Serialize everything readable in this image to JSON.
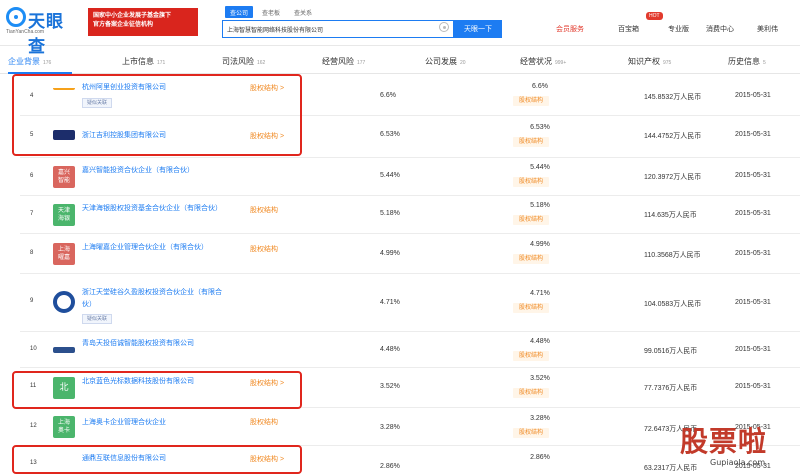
{
  "header": {
    "logo_text": "天眼查",
    "logo_domain": "TianYanCha.com",
    "gov_badge_line1": "国家中小企业发展子基金旗下",
    "gov_badge_line2": "官方备案企业征信机构",
    "search_tabs": [
      "查公司",
      "查老板",
      "查关系"
    ],
    "search_value": "上海智慧智能网络科技股份有限公司",
    "search_button": "天眼一下",
    "nav": {
      "vip": "会员服务",
      "hot": "HOT",
      "enterprise": "百宝箱",
      "pro": "专业版",
      "consume": "消费中心",
      "user": "美利伟"
    }
  },
  "tabs": [
    {
      "label": "企业背景",
      "count": "176"
    },
    {
      "label": "上市信息",
      "count": "171"
    },
    {
      "label": "司法风险",
      "count": "162"
    },
    {
      "label": "经营风险",
      "count": "177"
    },
    {
      "label": "公司发展",
      "count": "20"
    },
    {
      "label": "经营状况",
      "count": "999+"
    },
    {
      "label": "知识产权",
      "count": "975"
    },
    {
      "label": "历史信息",
      "count": "5"
    }
  ],
  "rows": [
    {
      "num": "4",
      "logo_text": "",
      "logo_color": "#f6a11a",
      "name": "杭州阿里创业投资有限公司",
      "tag": "疑似关联",
      "equity": "股权结构 >",
      "pct": "6.6%",
      "pct2": "6.6%",
      "capital": "145.8532万人民币",
      "date": "2015-05-31"
    },
    {
      "num": "5",
      "logo_text": "",
      "logo_color": "#1c2d6b",
      "name": "浙江吉利控股集团有限公司",
      "tag": "",
      "equity": "股权结构 >",
      "pct": "6.53%",
      "pct2": "6.53%",
      "capital": "144.4752万人民币",
      "date": "2015-05-31"
    },
    {
      "num": "6",
      "logo_text": "嘉兴\n智能",
      "logo_color": "#d9665e",
      "name": "嘉兴智能投资合伙企业（有限合伙）",
      "tag": "",
      "equity": "",
      "pct": "5.44%",
      "pct2": "5.44%",
      "capital": "120.3972万人民币",
      "date": "2015-05-31"
    },
    {
      "num": "7",
      "logo_text": "天津\n海银",
      "logo_color": "#4bb56c",
      "name": "天津海银股权投资基金合伙企业（有限合伙）",
      "tag": "",
      "equity": "股权结构",
      "pct": "5.18%",
      "pct2": "5.18%",
      "capital": "114.635万人民币",
      "date": "2015-05-31"
    },
    {
      "num": "8",
      "logo_text": "上海\n曜嘉",
      "logo_color": "#d9665e",
      "name": "上海曜嘉企业管理合伙企业（有限合伙）",
      "tag": "",
      "equity": "股权结构",
      "pct": "4.99%",
      "pct2": "4.99%",
      "capital": "110.3568万人民币",
      "date": "2015-05-31"
    },
    {
      "num": "9",
      "logo_text": "",
      "logo_color": "#1f4e9c",
      "name": "浙江天堂硅谷久盈股权投资合伙企业（有限合伙）",
      "tag": "疑似关联",
      "equity": "",
      "pct": "4.71%",
      "pct2": "4.71%",
      "capital": "104.0583万人民币",
      "date": "2015-05-31"
    },
    {
      "num": "10",
      "logo_text": "",
      "logo_color": "#2b4f8c",
      "name": "青岛天投佰诚智能股权投资有限公司",
      "tag": "",
      "equity": "",
      "pct": "4.48%",
      "pct2": "4.48%",
      "capital": "99.0516万人民币",
      "date": "2015-05-31"
    },
    {
      "num": "11",
      "logo_text": "北",
      "logo_color": "#4bb56c",
      "name": "北京蓝色光标数据科技股份有限公司",
      "tag": "",
      "equity": "股权结构 >",
      "pct": "3.52%",
      "pct2": "3.52%",
      "capital": "77.7376万人民币",
      "date": "2015-05-31"
    },
    {
      "num": "12",
      "logo_text": "上海\n奥卡",
      "logo_color": "#4bb56c",
      "name": "上海奥卡企业管理合伙企业",
      "tag": "",
      "equity": "股权结构",
      "pct": "3.28%",
      "pct2": "3.28%",
      "capital": "72.6473万人民币",
      "date": "2015-05-31"
    },
    {
      "num": "13",
      "logo_text": "",
      "logo_color": "#ffffff",
      "name": "通鼎互联信息股份有限公司",
      "tag": "",
      "equity": "股权结构 >",
      "pct": "2.86%",
      "pct2": "2.86%",
      "capital": "63.2317万人民币",
      "date": "2015-05-31"
    }
  ],
  "equity_btn_label": "股权结构",
  "watermark": {
    "text": "股票啦",
    "url": "Gupiaola.com"
  }
}
